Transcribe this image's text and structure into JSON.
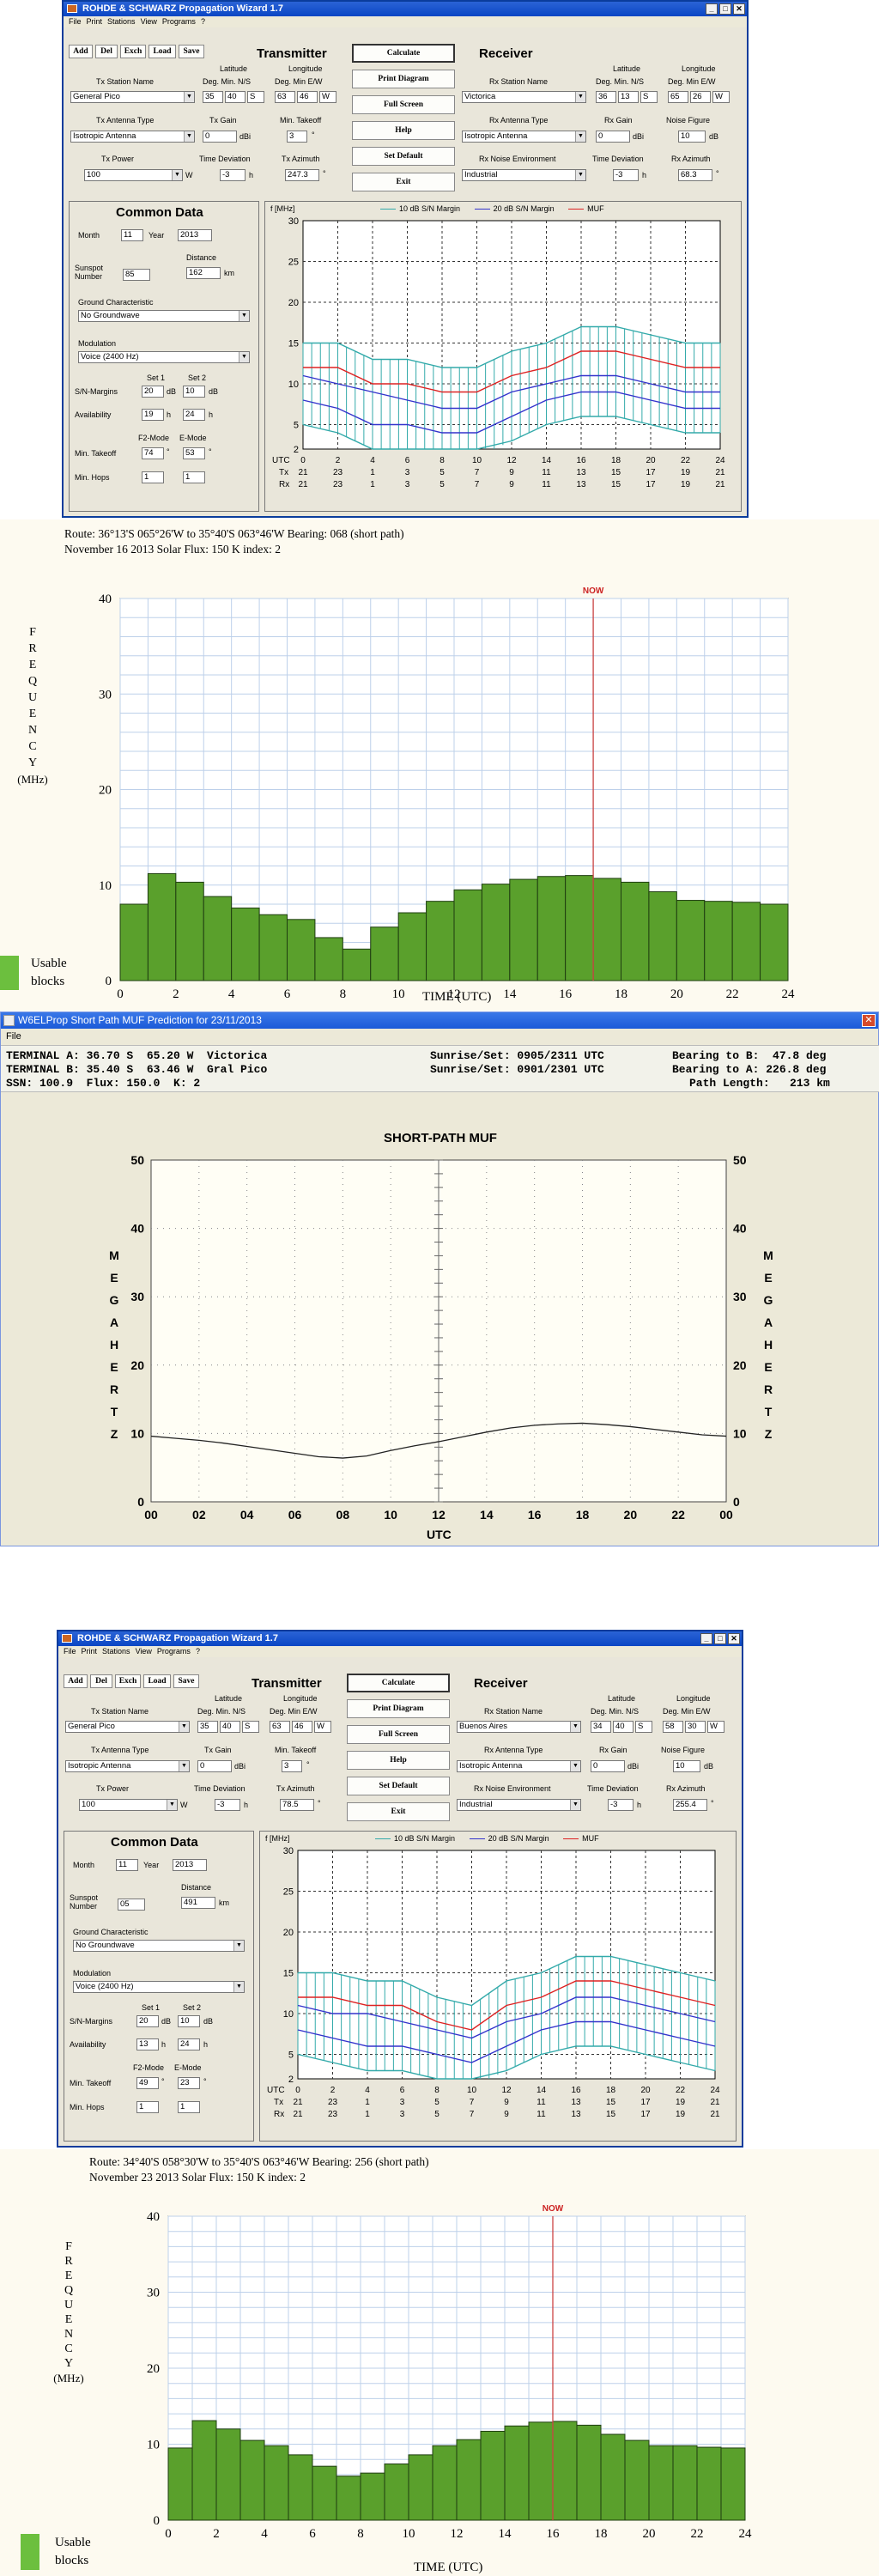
{
  "w1": {
    "title": "ROHDE & SCHWARZ    Propagation Wizard  1.7",
    "menu": [
      "File",
      "Print",
      "Stations",
      "View",
      "Programs",
      "?"
    ],
    "toolbar": [
      "Add",
      "Del",
      "Exch",
      "Load",
      "Save"
    ],
    "transmitter_hdr": "Transmitter",
    "receiver_hdr": "Receiver",
    "buttons": [
      "Calculate",
      "Print Diagram",
      "Full Screen",
      "Help",
      "Set Default",
      "Exit"
    ],
    "lat_hdr": "Latitude",
    "lon_hdr": "Longitude",
    "deg_min_ns": "Deg. Min. N/S",
    "deg_min_ew": "Deg. Min E/W",
    "tx_station_lbl": "Tx Station Name",
    "tx_station": "General Pico",
    "tx_lat": [
      "35",
      "40",
      "S"
    ],
    "tx_lon": [
      "63",
      "46",
      "W"
    ],
    "rx_station_lbl": "Rx Station Name",
    "rx_station": "Victorica",
    "rx_lat": [
      "36",
      "13",
      "S"
    ],
    "rx_lon": [
      "65",
      "26",
      "W"
    ],
    "tx_ant_lbl": "Tx Antenna Type",
    "tx_ant": "Isotropic Antenna",
    "tx_gain_lbl": "Tx Gain",
    "tx_gain": "0",
    "dbi": "dBi",
    "min_takeoff_lbl": "Min. Takeoff",
    "min_takeoff": "3",
    "deg": "°",
    "rx_ant_lbl": "Rx Antenna Type",
    "rx_ant": "Isotropic Antenna",
    "rx_gain_lbl": "Rx Gain",
    "rx_gain": "0",
    "noise_fig_lbl": "Noise Figure",
    "noise_fig": "10",
    "db": "dB",
    "tx_power_lbl": "Tx Power",
    "tx_power": "100",
    "w": "W",
    "time_dev_lbl": "Time Deviation",
    "tx_time_dev": "-3",
    "h": "h",
    "tx_az_lbl": "Tx Azimuth",
    "tx_az": "247.3",
    "rx_noise_lbl": "Rx Noise Environment",
    "rx_noise": "Industrial",
    "rx_time_dev": "-3",
    "rx_az_lbl": "Rx Azimuth",
    "rx_az": "68.3",
    "common_hdr": "Common Data",
    "month_lbl": "Month",
    "month": "11",
    "year_lbl": "Year",
    "year": "2013",
    "sunspot_lbl": "Sunspot Number",
    "sunspot": "85",
    "distance_lbl": "Distance",
    "distance": "162",
    "km": "km",
    "ground_lbl": "Ground Characteristic",
    "ground": "No Groundwave",
    "mod_lbl": "Modulation",
    "mod": "Voice   (2400 Hz)",
    "set1": "Set 1",
    "set2": "Set 2",
    "sn_lbl": "S/N-Margins",
    "sn1": "20",
    "sn2": "10",
    "avail_lbl": "Availability",
    "av1": "19",
    "av2": "24",
    "f2_lbl": "F2-Mode",
    "e_lbl": "E-Mode",
    "mt_lbl": "Min. Takeoff",
    "mt1": "74",
    "mt2": "53",
    "hops_lbl": "Min. Hops",
    "hop1": "1",
    "hop2": "1",
    "chart_ylabel": "f [MHz]",
    "leg1": "10 dB S/N Margin",
    "leg2": "20 dB S/N Margin",
    "leg3": "MUF",
    "utc": "UTC",
    "tx": "Tx",
    "rx": "Rx",
    "utc_ticks": [
      "0",
      "2",
      "4",
      "6",
      "8",
      "10",
      "12",
      "14",
      "16",
      "18",
      "20",
      "22",
      "24"
    ],
    "tx_ticks": [
      "21",
      "23",
      "1",
      "3",
      "5",
      "7",
      "9",
      "11",
      "13",
      "15",
      "17",
      "19",
      "21"
    ],
    "rx_ticks": [
      "21",
      "23",
      "1",
      "3",
      "5",
      "7",
      "9",
      "11",
      "13",
      "15",
      "17",
      "19",
      "21"
    ],
    "y_ticks": [
      "30",
      "25",
      "20",
      "15",
      "10",
      "5",
      "2"
    ]
  },
  "p1": {
    "route": "Route:   36°13'S 065°26'W  to  35°40'S 063°46'W   Bearing: 068   (short path)",
    "date": "November 16 2013   Solar Flux:  150    K index:  2",
    "freq_lbl": [
      "F",
      "R",
      "E",
      "Q",
      "U",
      "E",
      "N",
      "C",
      "Y",
      "(MHz)"
    ],
    "now": "NOW",
    "xlabel": "TIME (UTC)",
    "usable": "Usable blocks"
  },
  "w6": {
    "title": "W6ELProp Short Path MUF Prediction for 23/11/2013",
    "menu": "File",
    "l1a": "TERMINAL A: 36.70 S  65.20 W  Victorica",
    "l1b": "Sunrise/Set: 0905/2311 UTC",
    "l1c": "Bearing to B:  47.8 deg",
    "l2a": "TERMINAL B: 35.40 S  63.46 W  Gral Pico",
    "l2b": "Sunrise/Set: 0901/2301 UTC",
    "l2c": "Bearing to A: 226.8 deg",
    "l3a": "SSN: 100.9  Flux: 150.0  K: 2",
    "l3c": "Path Length:   213 km",
    "ctitle": "SHORT-PATH MUF",
    "side": [
      "M",
      "E",
      "G",
      "A",
      "H",
      "E",
      "R",
      "T",
      "Z"
    ],
    "x": "UTC",
    "xticks": [
      "00",
      "02",
      "04",
      "06",
      "08",
      "10",
      "12",
      "14",
      "16",
      "18",
      "20",
      "22",
      "00"
    ],
    "yticks": [
      "50",
      "40",
      "30",
      "20",
      "10",
      "0"
    ]
  },
  "w2": {
    "title": "ROHDE & SCHWARZ    Propagation Wizard  1.7",
    "tx_station": "General Pico",
    "tx_lat": [
      "35",
      "40",
      "S"
    ],
    "tx_lon": [
      "63",
      "46",
      "W"
    ],
    "rx_station": "Buenos Aires",
    "rx_lat": [
      "34",
      "40",
      "S"
    ],
    "rx_lon": [
      "58",
      "30",
      "W"
    ],
    "tx_ant": "Isotropic Antenna",
    "tx_gain": "0",
    "min_takeoff": "3",
    "rx_ant": "Isotropic Antenna",
    "rx_gain": "0",
    "noise_fig": "10",
    "tx_power": "100",
    "tx_time_dev": "-3",
    "tx_az": "78.5",
    "rx_noise": "Industrial",
    "rx_time_dev": "-3",
    "rx_az": "255.4",
    "month": "11",
    "year": "2013",
    "sunspot": "05",
    "distance": "491",
    "ground": "No Groundwave",
    "mod": "Voice   (2400 Hz)",
    "sn1": "20",
    "sn2": "10",
    "av1": "13",
    "av2": "24",
    "mt1": "49",
    "mt2": "23",
    "hop1": "1",
    "hop2": "1"
  },
  "p2": {
    "route": "Route:   34°40'S 058°30'W  to  35°40'S 063°46'W   Bearing: 256   (short path)",
    "date": "November 23 2013   Solar Flux:  150    K index:  2",
    "now": "NOW",
    "xlabel": "TIME (UTC)",
    "usable": "Usable blocks"
  },
  "chart_data": [
    {
      "type": "area",
      "title": "",
      "ylabel": "f [MHz]",
      "xlabel": "UTC",
      "x": [
        0,
        2,
        4,
        6,
        8,
        10,
        12,
        14,
        16,
        18,
        20,
        22,
        24
      ],
      "ylim": [
        2,
        30
      ],
      "series": [
        {
          "name": "MUF",
          "values": [
            12,
            12,
            10,
            10,
            9,
            9,
            11,
            12,
            14,
            14,
            13,
            12,
            12
          ]
        },
        {
          "name": "10 dB S/N Margin",
          "values": [
            11,
            10,
            9,
            8,
            7,
            7,
            9,
            10,
            11,
            11,
            10,
            9,
            9
          ]
        },
        {
          "name": "20 dB S/N Margin",
          "values": [
            8,
            7,
            5,
            5,
            4,
            4,
            6,
            8,
            9,
            9,
            8,
            7,
            7
          ]
        }
      ]
    },
    {
      "type": "bar",
      "xlabel": "TIME (UTC)",
      "ylabel": "FREQUENCY (MHz)",
      "ylim": [
        0,
        40
      ],
      "xlim": [
        0,
        24
      ],
      "now_x": 17,
      "values": [
        8,
        11.2,
        10.3,
        8.8,
        7.6,
        6.9,
        6.4,
        4.5,
        3.3,
        5.6,
        7.1,
        8.3,
        9.5,
        10.1,
        10.6,
        10.9,
        11.0,
        10.7,
        10.3,
        9.3,
        8.4,
        8.3,
        8.2,
        8.0
      ]
    },
    {
      "type": "line",
      "title": "SHORT-PATH MUF",
      "xlabel": "UTC",
      "ylabel": "MEGAHERTZ",
      "ylim": [
        0,
        50
      ],
      "xticks": [
        "00",
        "02",
        "04",
        "06",
        "08",
        "10",
        "12",
        "14",
        "16",
        "18",
        "20",
        "22",
        "00"
      ],
      "x": [
        0,
        1,
        2,
        3,
        4,
        5,
        6,
        7,
        8,
        9,
        10,
        11,
        12,
        13,
        14,
        15,
        16,
        17,
        18,
        19,
        20,
        21,
        22,
        23,
        24
      ],
      "values": [
        9.6,
        9.3,
        9.0,
        8.6,
        8.1,
        7.6,
        7.1,
        6.6,
        6.4,
        6.7,
        7.5,
        8.2,
        8.8,
        9.5,
        10.2,
        10.8,
        11.2,
        11.4,
        11.5,
        11.3,
        11.0,
        10.6,
        10.2,
        9.8,
        9.6
      ]
    },
    {
      "type": "area",
      "ylabel": "f [MHz]",
      "xlabel": "UTC",
      "x": [
        0,
        2,
        4,
        6,
        8,
        10,
        12,
        14,
        16,
        18,
        20,
        22,
        24
      ],
      "ylim": [
        2,
        30
      ],
      "series": [
        {
          "name": "MUF",
          "values": [
            12,
            12,
            11,
            11,
            9,
            8,
            11,
            12,
            14,
            14,
            13,
            12,
            11
          ]
        },
        {
          "name": "10 dB S/N Margin",
          "values": [
            11,
            10,
            10,
            9,
            8,
            7,
            9,
            10,
            12,
            12,
            11,
            10,
            9
          ]
        },
        {
          "name": "20 dB S/N Margin",
          "values": [
            8,
            7,
            6,
            6,
            5,
            4,
            6,
            8,
            9,
            9,
            8,
            7,
            6
          ]
        }
      ]
    },
    {
      "type": "bar",
      "xlabel": "TIME (UTC)",
      "ylabel": "FREQUENCY (MHz)",
      "ylim": [
        0,
        40
      ],
      "xlim": [
        0,
        24
      ],
      "now_x": 16,
      "values": [
        9.5,
        13.1,
        12.0,
        10.5,
        9.8,
        8.6,
        7.1,
        5.8,
        6.2,
        7.4,
        8.6,
        9.8,
        10.6,
        11.7,
        12.4,
        12.9,
        13.0,
        12.5,
        11.3,
        10.5,
        9.8,
        9.8,
        9.6,
        9.5
      ]
    }
  ]
}
